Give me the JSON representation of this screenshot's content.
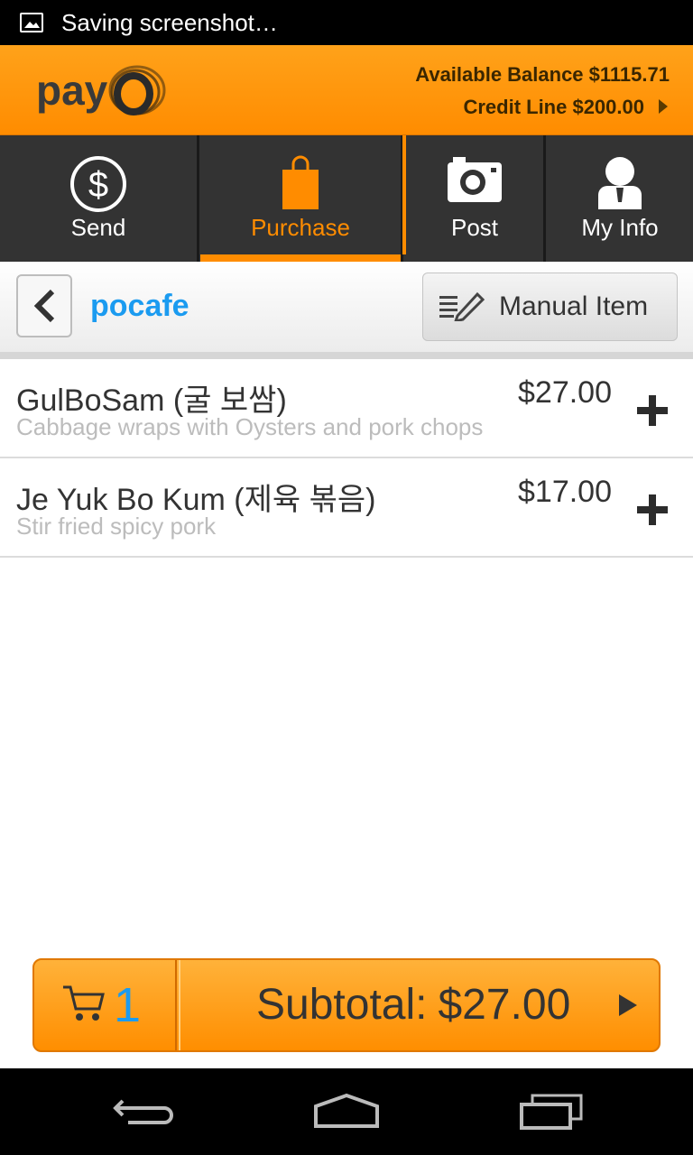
{
  "status_bar": {
    "text": "Saving screenshot…",
    "icon": "image-icon"
  },
  "header": {
    "logo": "payo",
    "available_balance": "Available Balance $1115.71",
    "credit_line": "Credit Line $200.00"
  },
  "nav": {
    "tabs": [
      {
        "label": "Send",
        "icon": "dollar-icon",
        "active": false
      },
      {
        "label": "Purchase",
        "icon": "shopping-bag-icon",
        "active": true
      },
      {
        "label": "Post",
        "icon": "camera-icon",
        "active": false
      },
      {
        "label": "My Info",
        "icon": "person-icon",
        "active": false
      }
    ]
  },
  "subheader": {
    "store_name": "pocafe",
    "manual_item_label": "Manual Item"
  },
  "items": [
    {
      "name": "GulBoSam (굴 보쌈)",
      "description": "Cabbage wraps with Oysters and pork chops",
      "price": "$27.00"
    },
    {
      "name": "Je Yuk Bo Kum (제육 볶음)",
      "description": "Stir fried spicy pork",
      "price": "$17.00"
    }
  ],
  "cart": {
    "count": "1",
    "subtotal_label": "Subtotal:",
    "subtotal_value": "$27.00"
  },
  "colors": {
    "accent": "#ff8c00",
    "link": "#1b9bf0",
    "nav_bg": "#333333"
  }
}
